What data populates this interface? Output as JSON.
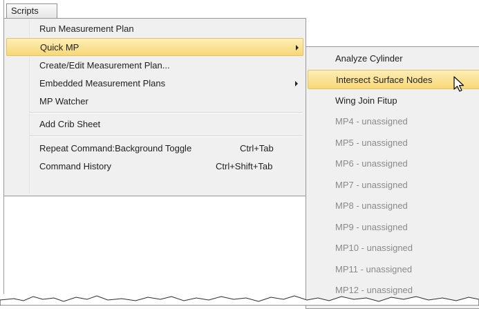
{
  "menubar": {
    "scripts_label": "Scripts"
  },
  "menu": {
    "items": [
      {
        "label": "Run Measurement Plan"
      },
      {
        "label": "Quick MP"
      },
      {
        "label": "Create/Edit Measurement Plan..."
      },
      {
        "label": "Embedded Measurement Plans"
      },
      {
        "label": "MP Watcher"
      },
      {
        "label": "Add Crib Sheet"
      },
      {
        "label": "Repeat Command:Background Toggle",
        "shortcut": "Ctrl+Tab"
      },
      {
        "label": "Command History",
        "shortcut": "Ctrl+Shift+Tab"
      }
    ]
  },
  "submenu": {
    "items": [
      {
        "label": "Analyze Cylinder"
      },
      {
        "label": "Intersect Surface Nodes"
      },
      {
        "label": "Wing Join Fitup"
      },
      {
        "label": "MP4 - unassigned"
      },
      {
        "label": "MP5 - unassigned"
      },
      {
        "label": "MP6 - unassigned"
      },
      {
        "label": "MP7 - unassigned"
      },
      {
        "label": "MP8 - unassigned"
      },
      {
        "label": "MP9 - unassigned"
      },
      {
        "label": "MP10 - unassigned"
      },
      {
        "label": "MP11 - unassigned"
      },
      {
        "label": "MP12 - unassigned"
      }
    ]
  },
  "colors": {
    "highlight": "#f8d877",
    "menu_bg": "#f0f0f0",
    "disabled_text": "#8a8a8a"
  },
  "icons": {
    "submenu_arrow": "chevron-right-icon",
    "cursor": "mouse-pointer-icon"
  }
}
